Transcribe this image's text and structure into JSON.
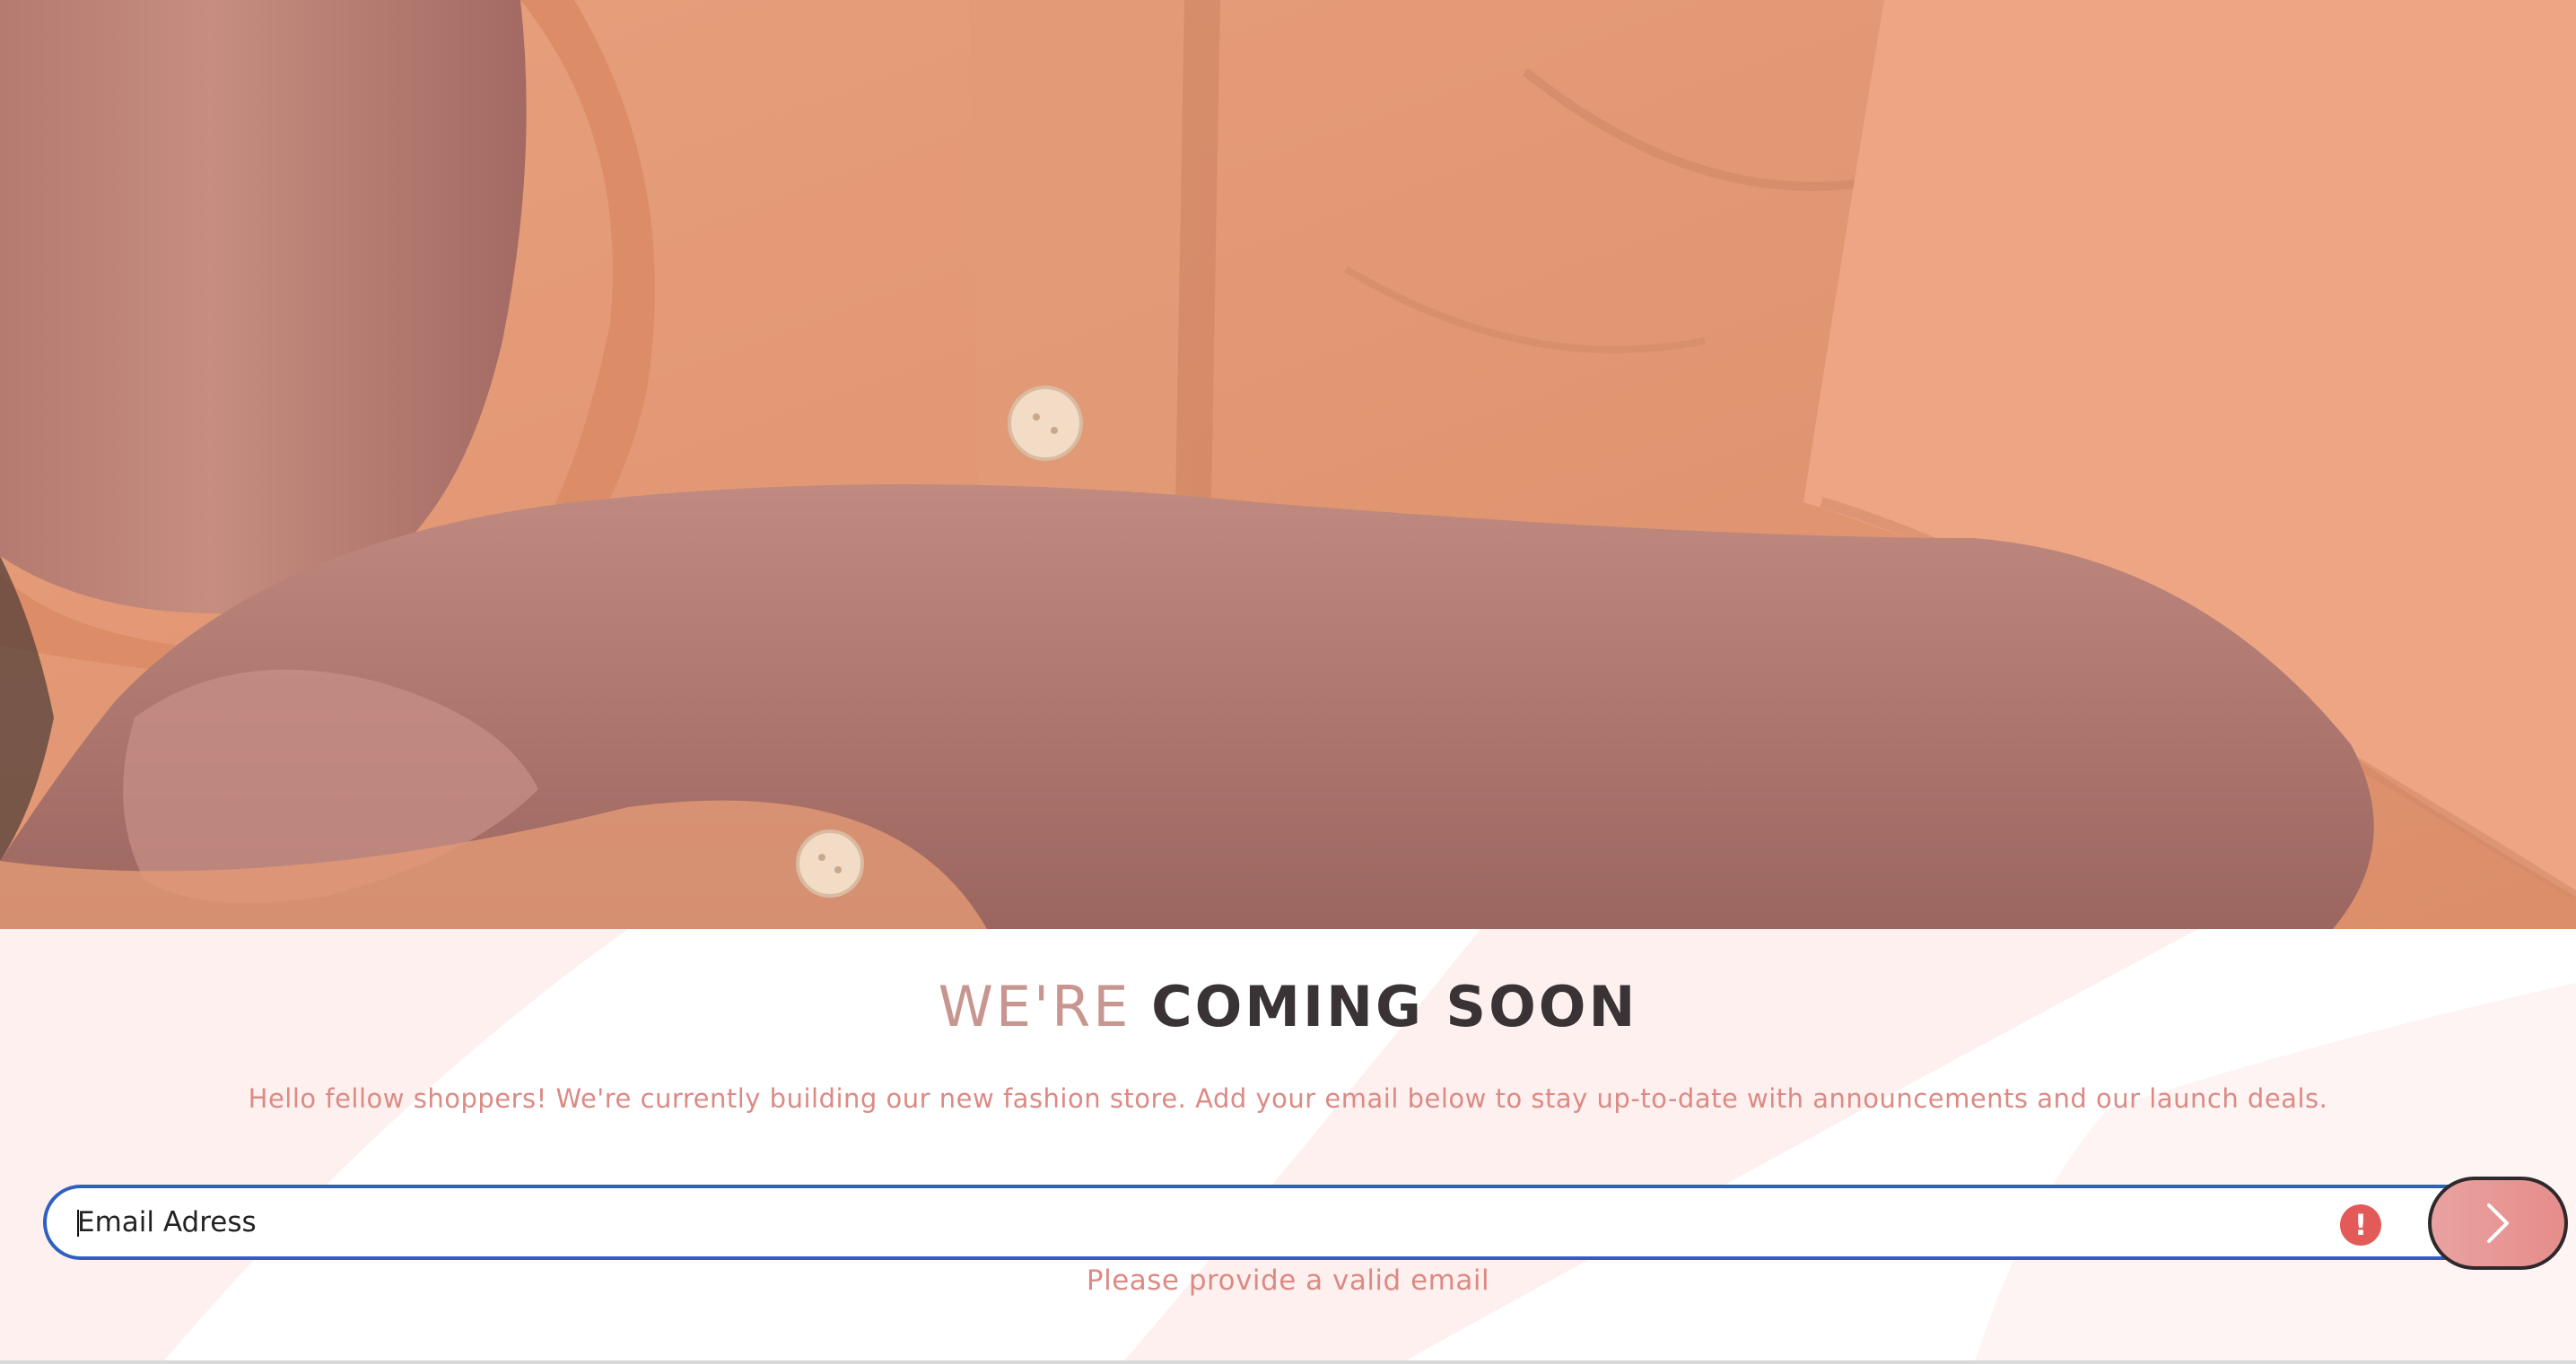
{
  "hero": {
    "image_alt": "",
    "icon": "hero-photo"
  },
  "headline": {
    "light": "WE'RE",
    "bold": "COMING SOON"
  },
  "subtext": "Hello fellow shoppers! We're currently building our new fashion store. Add your email below to stay up-to-date with announcements and our launch deals.",
  "form": {
    "email_value": "",
    "email_placeholder": "Email Adress",
    "error_icon": "exclamation-icon",
    "submit_icon": "chevron-right-icon",
    "error_message": "Please provide a valid email"
  },
  "colors": {
    "accent_pink": "#dc8a84",
    "headline_light": "#c79690",
    "headline_dark": "#3a3335",
    "focus_border": "#2f5fc4",
    "error_red": "#e25b58",
    "button_fill": "#e9a2a0"
  }
}
